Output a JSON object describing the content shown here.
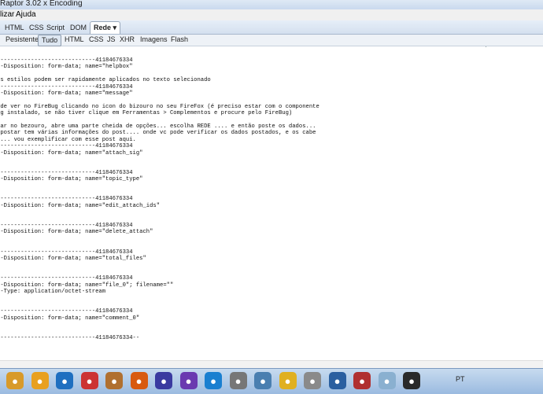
{
  "window": {
    "title": "Raptor 3.02 x Encoding"
  },
  "menu": {
    "items": [
      "lizar",
      "Ajuda"
    ]
  },
  "panel_tabs": [
    "HTML",
    "CSS",
    "Script",
    "DOM",
    "Rede"
  ],
  "active_tab": "Rede",
  "net_filters": [
    "Pesistente",
    "Tudo",
    "HTML",
    "CSS",
    "JS",
    "XHR",
    "Imagens",
    "Flash"
  ],
  "active_filter": "Tudo",
  "post_body": [
    "-----------------------------41184676334",
    "t-Disposition: form-data; name=\"helpbox\"",
    "",
    "os estilos podem ser rapidamente aplicados no texto selecionado",
    "-----------------------------41184676334",
    "t-Disposition: form-data; name=\"message\"",
    "",
    "ode ver no FireBug clicando no icon do bizouro no seu FireFox (é preciso estar com o componente",
    "ug instalado, se não tiver clique em Ferramentas > Complementos e procure pelo FireBug)",
    "",
    "car no bezouro, abre uma parte cheida de opções... escolha REDE .... e então poste os dados...",
    " postar tem várias informações do post.... onde vc pode verificar os dados postados, e os cabe",
    ".... vou exemplificar com esse post aqui.",
    "-----------------------------41184676334",
    "t-Disposition: form-data; name=\"attach_sig\"",
    "",
    "",
    "-----------------------------41184676334",
    "t-Disposition: form-data; name=\"topic_type\"",
    "",
    "",
    "-----------------------------41184676334",
    "t-Disposition: form-data; name=\"edit_attach_ids\"",
    "",
    "",
    "-----------------------------41184676334",
    "t-Disposition: form-data; name=\"delete_attach\"",
    "",
    "",
    "-----------------------------41184676334",
    "t-Disposition: form-data; name=\"total_files\"",
    "",
    "",
    "-----------------------------41184676334",
    "t-Disposition: form-data; name=\"file_0\"; filename=\"\"",
    "t-Type: application/octet-stream",
    "",
    "",
    "-----------------------------41184676334",
    "t-Disposition: form-data; name=\"comment_0\"",
    "",
    "",
    "-----------------------------41184676334--"
  ],
  "taskbar": {
    "apps": [
      "explorer-icon",
      "media-player-icon",
      "ie-icon",
      "chrome-icon",
      "java-icon",
      "firefox-icon",
      "eclipse-icon",
      "vs-icon",
      "quicktime-icon",
      "settings-icon",
      "network-icon",
      "notes-icon",
      "tools-icon",
      "virtualbox-icon",
      "archive-icon",
      "paint-icon",
      "console-icon"
    ],
    "tray_lang": "PT"
  }
}
